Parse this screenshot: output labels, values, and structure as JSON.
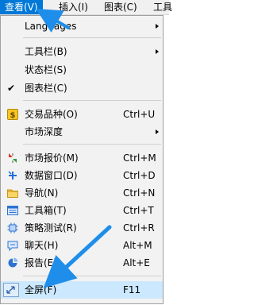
{
  "menubar": {
    "items": [
      {
        "label": "查看(V)"
      },
      {
        "label": "插入(I)"
      },
      {
        "label": "图表(C)"
      },
      {
        "label": "工具"
      }
    ]
  },
  "menu": {
    "languages": {
      "label": "Languages"
    },
    "toolbars": {
      "label": "工具栏(B)"
    },
    "status_bar": {
      "label": "状态栏(S)"
    },
    "chart_bar": {
      "label": "图表栏(C)",
      "checked": "✔"
    },
    "symbols": {
      "label": "交易品种(O)",
      "shortcut": "Ctrl+U"
    },
    "market_depth": {
      "label": "市场深度"
    },
    "market_watch": {
      "label": "市场报价(M)",
      "shortcut": "Ctrl+M"
    },
    "data_window": {
      "label": "数据窗口(D)",
      "shortcut": "Ctrl+D"
    },
    "navigator": {
      "label": "导航(N)",
      "shortcut": "Ctrl+N"
    },
    "toolbox": {
      "label": "工具箱(T)",
      "shortcut": "Ctrl+T"
    },
    "strategy_tester": {
      "label": "策略测试(R)",
      "shortcut": "Ctrl+R"
    },
    "chat": {
      "label": "聊天(H)",
      "shortcut": "Alt+M"
    },
    "reports": {
      "label": "报告(E)",
      "shortcut": "Alt+E"
    },
    "fullscreen": {
      "label": "全屏(F)",
      "shortcut": "F11"
    }
  },
  "icons": {
    "symbols": "dollar-icon",
    "market_watch": "market-watch-icon",
    "data_window": "data-window-icon",
    "navigator": "folder-icon",
    "toolbox": "toolbox-icon",
    "strategy_tester": "chip-icon",
    "chat": "chat-icon",
    "reports": "report-icon",
    "fullscreen": "fullscreen-icon"
  },
  "colors": {
    "accent": "#0078d7",
    "annotation": "#1e8eea",
    "hover": "#cce8ff"
  }
}
